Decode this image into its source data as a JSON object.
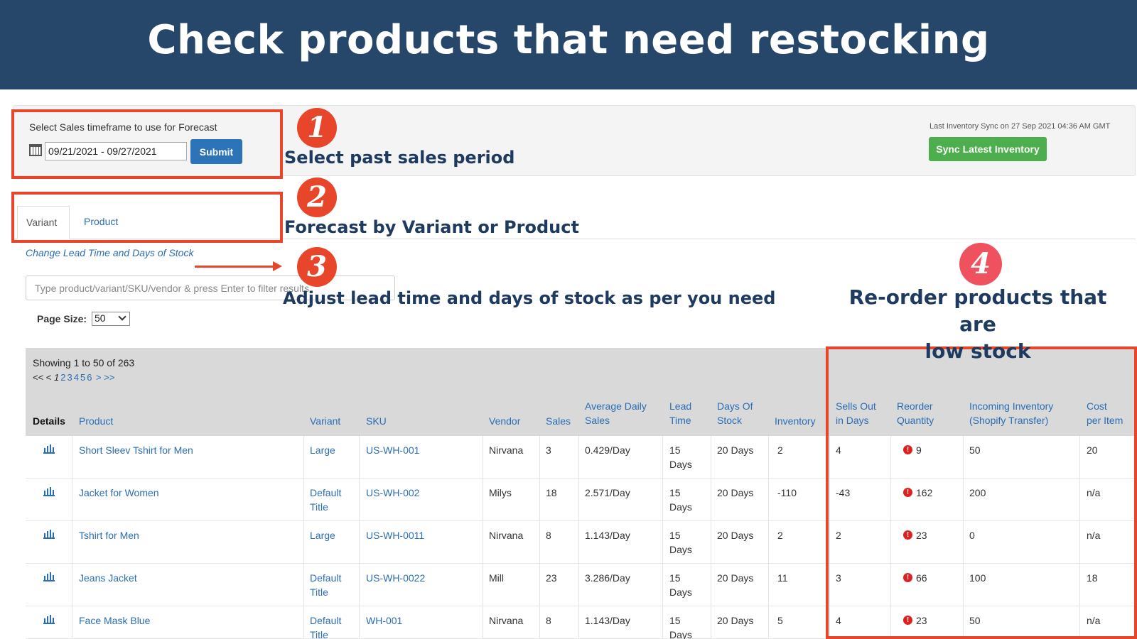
{
  "banner": {
    "title": "Check products that need restocking"
  },
  "controls": {
    "timeframe_label": "Select Sales timeframe to use for Forecast",
    "date_range": "09/21/2021 - 09/27/2021",
    "submit_label": "Submit",
    "sync_text": "Last Inventory Sync on 27 Sep 2021 04:36 AM GMT",
    "sync_label": "Sync Latest Inventory"
  },
  "tabs": [
    {
      "label": "Variant"
    },
    {
      "label": "Product"
    }
  ],
  "lead_link": "Change Lead Time and Days of Stock",
  "filter": {
    "placeholder": "Type product/variant/SKU/vendor & press Enter to filter results"
  },
  "page_size": {
    "label": "Page Size:",
    "value": "50"
  },
  "showing": "Showing 1 to 50 of 263",
  "pager": {
    "prev": "<< <",
    "current": "1",
    "pages": [
      "2",
      "3",
      "4",
      "5",
      "6"
    ],
    "next": "> >>"
  },
  "table": {
    "headers": {
      "details": "Details",
      "product": "Product",
      "variant": "Variant",
      "sku": "SKU",
      "vendor": "Vendor",
      "sales": "Sales",
      "avg1": "Average Daily",
      "avg2": "Sales",
      "lead1": "Lead",
      "lead2": "Time",
      "days1": "Days Of",
      "days2": "Stock",
      "inventory": "Inventory",
      "sells1": "Sells Out",
      "sells2": "in Days",
      "reorder1": "Reorder",
      "reorder2": "Quantity",
      "incoming1": "Incoming Inventory",
      "incoming2": "(Shopify Transfer)",
      "cost1": "Cost",
      "cost2": "per Item"
    },
    "rows": [
      {
        "product": "Short Sleev Tshirt for Men",
        "variant1": "Large",
        "variant2": "",
        "sku": "US-WH-001",
        "vendor": "Nirvana",
        "sales": "3",
        "avg": "0.429/Day",
        "lead1": "15",
        "lead2": "Days",
        "days": "20 Days",
        "inventory": "2",
        "sells": "4",
        "reorder": "9",
        "incoming": "50",
        "cost": "20"
      },
      {
        "product": "Jacket for Women",
        "variant1": "Default",
        "variant2": "Title",
        "sku": "US-WH-002",
        "vendor": "Milys",
        "sales": "18",
        "avg": "2.571/Day",
        "lead1": "15",
        "lead2": "Days",
        "days": "20 Days",
        "inventory": "-110",
        "sells": "-43",
        "reorder": "162",
        "incoming": "200",
        "cost": "n/a"
      },
      {
        "product": "Tshirt for Men",
        "variant1": "Large",
        "variant2": "",
        "sku": "US-WH-0011",
        "vendor": "Nirvana",
        "sales": "8",
        "avg": "1.143/Day",
        "lead1": "15",
        "lead2": "Days",
        "days": "20 Days",
        "inventory": "2",
        "sells": "2",
        "reorder": "23",
        "incoming": "0",
        "cost": "n/a"
      },
      {
        "product": "Jeans Jacket",
        "variant1": "Default",
        "variant2": "Title",
        "sku": "US-WH-0022",
        "vendor": "Mill",
        "sales": "23",
        "avg": "3.286/Day",
        "lead1": "15",
        "lead2": "Days",
        "days": "20 Days",
        "inventory": "11",
        "sells": "3",
        "reorder": "66",
        "incoming": "100",
        "cost": "18"
      },
      {
        "product": "Face Mask  Blue",
        "variant1": "Default",
        "variant2": "Title",
        "sku": "WH-001",
        "vendor": "Nirvana",
        "sales": "8",
        "avg": "1.143/Day",
        "lead1": "15",
        "lead2": "Days",
        "days": "20 Days",
        "inventory": "5",
        "sells": "4",
        "reorder": "23",
        "incoming": "50",
        "cost": "n/a"
      }
    ]
  },
  "annotations": {
    "n1": "1",
    "t1": "Select past sales period",
    "n2": "2",
    "t2": "Forecast  by Variant or Product",
    "n3": "3",
    "t3": "Adjust lead time and days of stock as per you need",
    "n4": "4",
    "t4a": "Re-order products that are",
    "t4b": "low stock"
  },
  "colors": {
    "banner": "#26476a",
    "annotation_red": "#e8462a",
    "link_blue": "#2a6db5",
    "sync_green": "#4cae4c",
    "submit_blue": "#2d73b8"
  }
}
